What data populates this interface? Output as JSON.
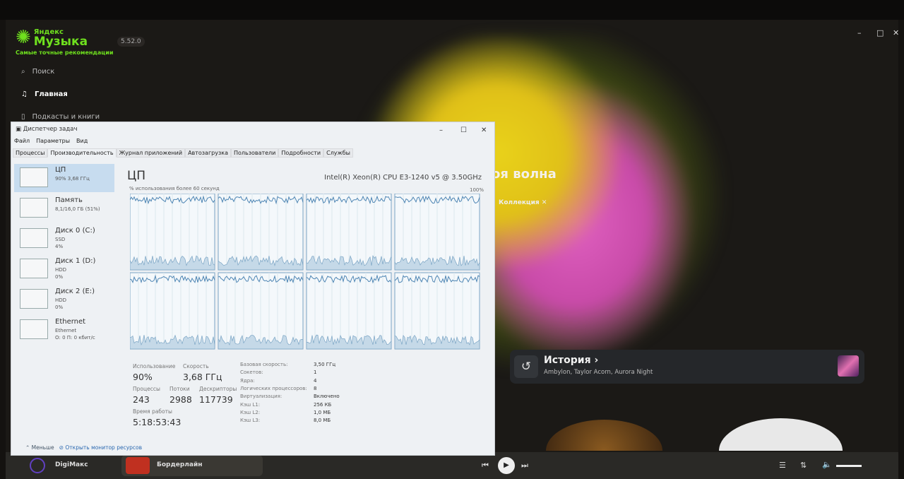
{
  "app": {
    "brand_top": "Яндекс",
    "brand_name": "Музыка",
    "tagline": "Самые точные рекомендации",
    "version": "5.52.0",
    "nav": [
      {
        "label": "Поиск",
        "icon": "search-icon"
      },
      {
        "label": "Главная",
        "icon": "music-note-icon"
      },
      {
        "label": "Подкасты и книги",
        "icon": "book-icon"
      }
    ],
    "window_controls": {
      "minimize": "–",
      "maximize": "□",
      "close": "✕"
    },
    "hero_title": "оя волна",
    "chip": "Коллекция",
    "chip_close": "✕",
    "history": {
      "title": "История",
      "arrow": "›",
      "artists": "Ambylon, Taylor Acorn, Aurora Night"
    },
    "player": {
      "user": "DigiМакс",
      "track": "Бордерлайн",
      "prev": "⏮",
      "play": "▶",
      "next": "⏭",
      "queue": "☰",
      "eq": "⇅",
      "volume": "🔈"
    }
  },
  "taskmgr": {
    "title": "Диспетчер задач",
    "controls": {
      "minimize": "–",
      "maximize": "☐",
      "close": "✕"
    },
    "menu": [
      "Файл",
      "Параметры",
      "Вид"
    ],
    "tabs": [
      "Процессы",
      "Производительность",
      "Журнал приложений",
      "Автозагрузка",
      "Пользователи",
      "Подробности",
      "Службы"
    ],
    "sidebar": [
      {
        "name": "ЦП",
        "line1": "90% 3,68 ГГц",
        "line2": ""
      },
      {
        "name": "Память",
        "line1": "8,1/16,0 ГБ (51%)",
        "line2": ""
      },
      {
        "name": "Диск 0 (C:)",
        "line1": "SSD",
        "line2": "4%"
      },
      {
        "name": "Диск 1 (D:)",
        "line1": "HDD",
        "line2": "0%"
      },
      {
        "name": "Диск 2 (E:)",
        "line1": "HDD",
        "line2": "0%"
      },
      {
        "name": "Ethernet",
        "line1": "Ethernet",
        "line2": "О: 0 П: 0 кбит/с"
      }
    ],
    "cpu": {
      "title": "ЦП",
      "model": "Intel(R) Xeon(R) CPU E3-1240 v5 @ 3.50GHz",
      "caption": "% использования более 60 секунд",
      "max": "100%",
      "usage_label": "Использование",
      "usage": "90%",
      "speed_label": "Скорость",
      "speed": "3,68 ГГц",
      "proc_label": "Процессы",
      "proc": "243",
      "threads_label": "Потоки",
      "threads": "2988",
      "handles_label": "Дескрипторы",
      "handles": "117739",
      "uptime_label": "Время работы",
      "uptime": "5:18:53:43",
      "details": [
        [
          "Базовая скорость:",
          "3,50 ГГц"
        ],
        [
          "Сокетов:",
          "1"
        ],
        [
          "Ядра:",
          "4"
        ],
        [
          "Логических процессоров:",
          "8"
        ],
        [
          "Виртуализация:",
          "Включено"
        ],
        [
          "Кэш L1:",
          "256 КБ"
        ],
        [
          "Кэш L2:",
          "1,0 МБ"
        ],
        [
          "Кэш L3:",
          "8,0 МБ"
        ]
      ]
    },
    "footer": {
      "less": "Меньше",
      "monitor": "Открыть монитор ресурсов"
    }
  }
}
